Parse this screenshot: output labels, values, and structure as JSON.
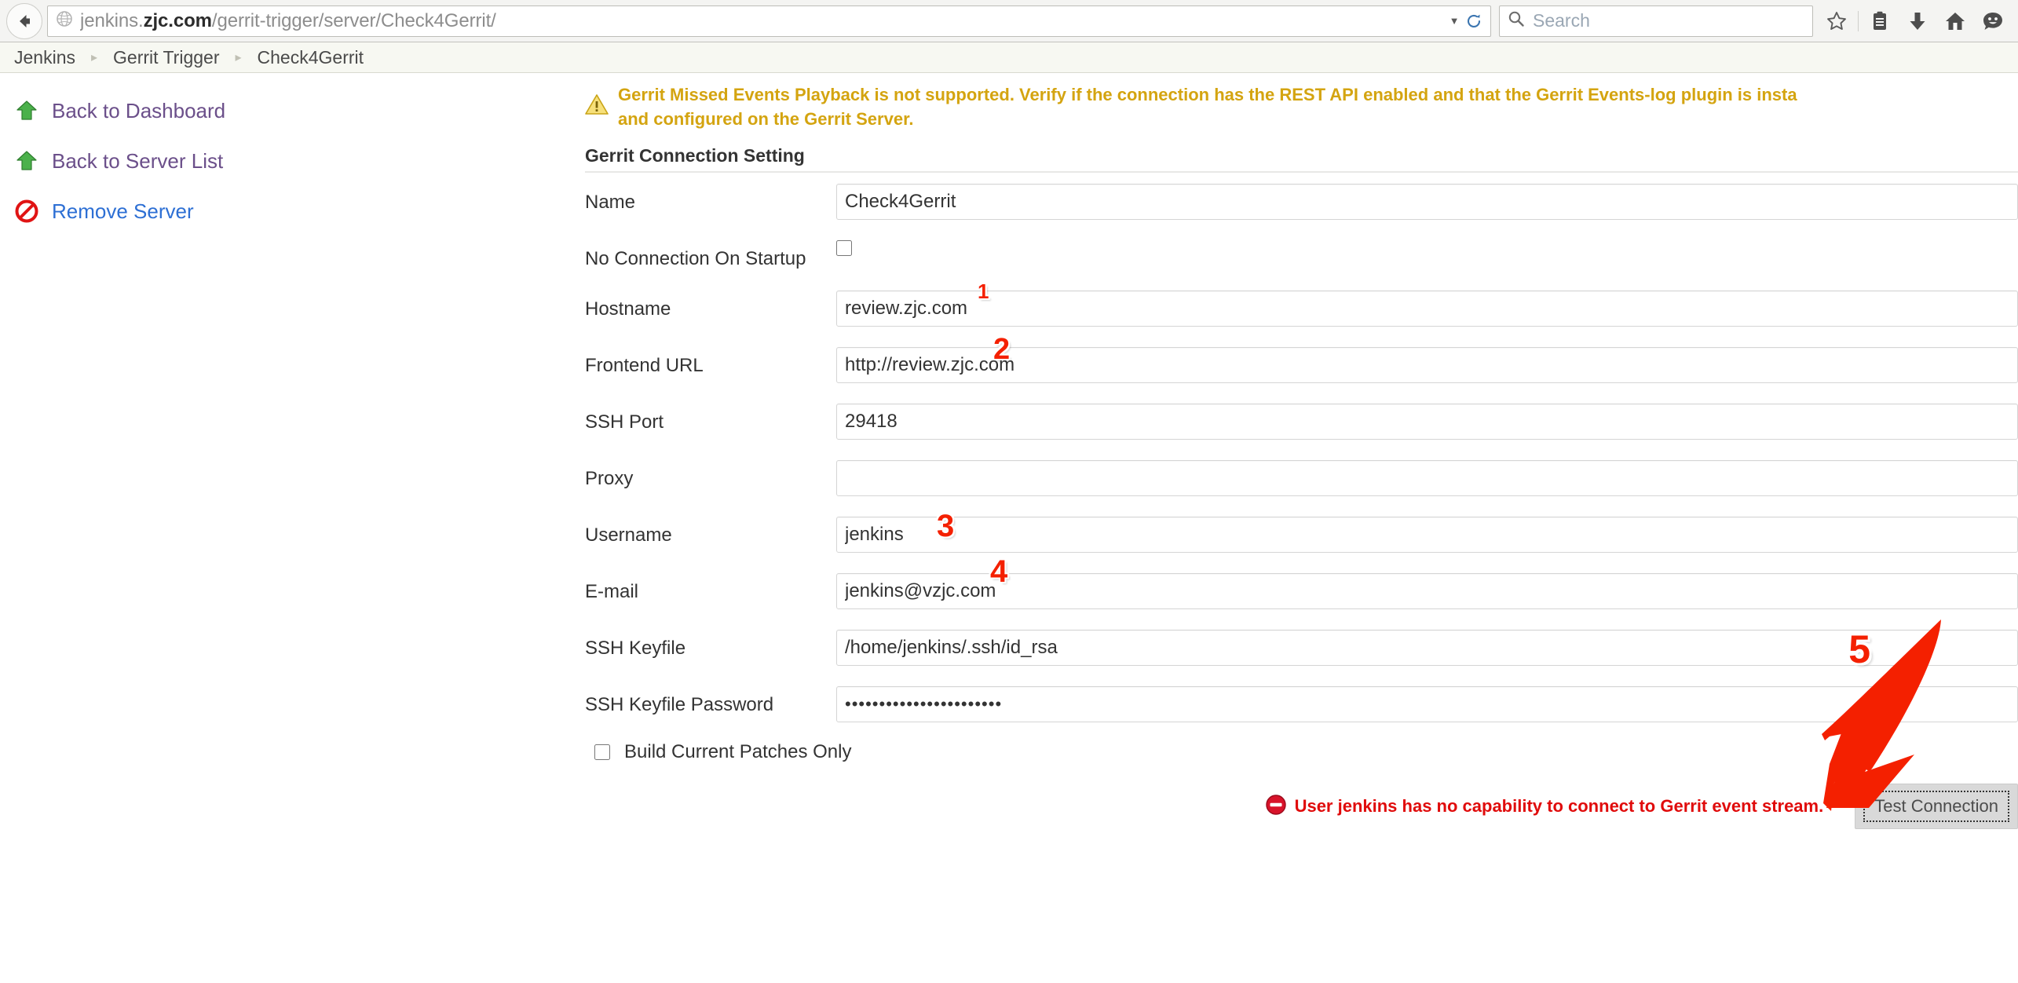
{
  "browser": {
    "back_tooltip": "Back",
    "url_prefix": "jenkins.",
    "url_bold": "zjc.com",
    "url_suffix": "/gerrit-trigger/server/Check4Gerrit/",
    "search_placeholder": "Search",
    "toolbar_icons": [
      "bookmark-star-icon",
      "library-icon",
      "downloads-icon",
      "home-icon",
      "feedback-smiley-icon"
    ]
  },
  "breadcrumb": {
    "items": [
      "Jenkins",
      "Gerrit Trigger",
      "Check4Gerrit"
    ],
    "separator": "▸"
  },
  "sidebar": {
    "items": [
      {
        "label": "Back to Dashboard",
        "icon": "up-arrow-green-icon",
        "style": "visited"
      },
      {
        "label": "Back to Server List",
        "icon": "up-arrow-green-icon",
        "style": "visited"
      },
      {
        "label": "Remove Server",
        "icon": "no-entry-red-icon",
        "style": "link"
      }
    ]
  },
  "main": {
    "warning": {
      "icon": "warning-triangle-icon",
      "line1": "Gerrit Missed Events Playback is not supported. Verify if the connection has the REST API enabled and that the Gerrit Events-log plugin is insta",
      "line2": "and configured on the Gerrit Server."
    },
    "section_title": "Gerrit Connection Setting",
    "fields": [
      {
        "label": "Name",
        "type": "text",
        "value": "Check4Gerrit",
        "annotation": ""
      },
      {
        "label": "No Connection On Startup",
        "type": "checkbox",
        "value": "",
        "checked": false,
        "annotation": ""
      },
      {
        "label": "Hostname",
        "type": "text",
        "value": "review.zjc.com",
        "annotation": "1"
      },
      {
        "label": "Frontend URL",
        "type": "text",
        "value": "http://review.zjc.com",
        "annotation": "2"
      },
      {
        "label": "SSH Port",
        "type": "text",
        "value": "29418",
        "annotation": ""
      },
      {
        "label": "Proxy",
        "type": "text",
        "value": "",
        "annotation": ""
      },
      {
        "label": "Username",
        "type": "text",
        "value": "jenkins",
        "annotation": "3"
      },
      {
        "label": "E-mail",
        "type": "text",
        "value": "jenkins@vzjc.com",
        "annotation": "4"
      },
      {
        "label": "SSH Keyfile",
        "type": "text",
        "value": "/home/jenkins/.ssh/id_rsa",
        "annotation": ""
      },
      {
        "label": "SSH Keyfile Password",
        "type": "password",
        "value": "•••••••••••••••••••••••",
        "annotation": ""
      }
    ],
    "build_current_patches_only": {
      "label": "Build Current Patches Only",
      "checked": false
    },
    "error": {
      "icon": "error-circle-icon",
      "text": "User jenkins has no capability to connect to Gerrit event stream."
    },
    "test_connection_label": "Test Connection",
    "callout_arrow_label": "5"
  },
  "colors": {
    "warning": "#d4a410",
    "error": "#e00b0b",
    "annotation_red": "#f42000",
    "link_blue": "#2d6fd4",
    "link_visited": "#6b4f8a"
  }
}
